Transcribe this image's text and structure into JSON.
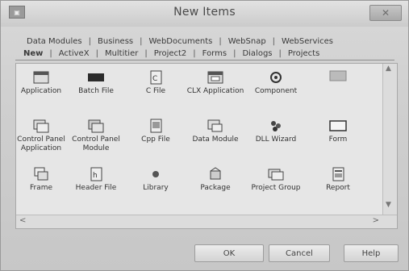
{
  "window": {
    "title": "New Items"
  },
  "tabs_top": [
    "Data Modules",
    "Business",
    "WebDocuments",
    "WebSnap",
    "WebServices"
  ],
  "tabs_bottom": [
    {
      "label": "New",
      "active": true
    },
    {
      "label": "ActiveX"
    },
    {
      "label": "Multitier"
    },
    {
      "label": "Project2"
    },
    {
      "label": "Forms"
    },
    {
      "label": "Dialogs"
    },
    {
      "label": "Projects"
    }
  ],
  "items": [
    {
      "label": "Application",
      "icon": "application-icon"
    },
    {
      "label": "Batch File",
      "icon": "batch-file-icon"
    },
    {
      "label": "C File",
      "icon": "c-file-icon"
    },
    {
      "label": "CLX Application",
      "icon": "clx-application-icon"
    },
    {
      "label": "Component",
      "icon": "component-icon"
    },
    {
      "label": "",
      "icon": "console-application-icon"
    },
    {
      "label": "Control Panel Application",
      "icon": "control-panel-application-icon"
    },
    {
      "label": "Control Panel Module",
      "icon": "control-panel-module-icon"
    },
    {
      "label": "Cpp File",
      "icon": "cpp-file-icon"
    },
    {
      "label": "Data Module",
      "icon": "data-module-icon"
    },
    {
      "label": "DLL Wizard",
      "icon": "dll-wizard-icon"
    },
    {
      "label": "Form",
      "icon": "form-icon"
    },
    {
      "label": "Frame",
      "icon": "frame-icon"
    },
    {
      "label": "Header File",
      "icon": "header-file-icon"
    },
    {
      "label": "Library",
      "icon": "library-icon"
    },
    {
      "label": "Package",
      "icon": "package-icon"
    },
    {
      "label": "Project Group",
      "icon": "project-group-icon"
    },
    {
      "label": "Report",
      "icon": "report-icon"
    }
  ],
  "buttons": {
    "ok": "OK",
    "cancel": "Cancel",
    "help": "Help"
  }
}
